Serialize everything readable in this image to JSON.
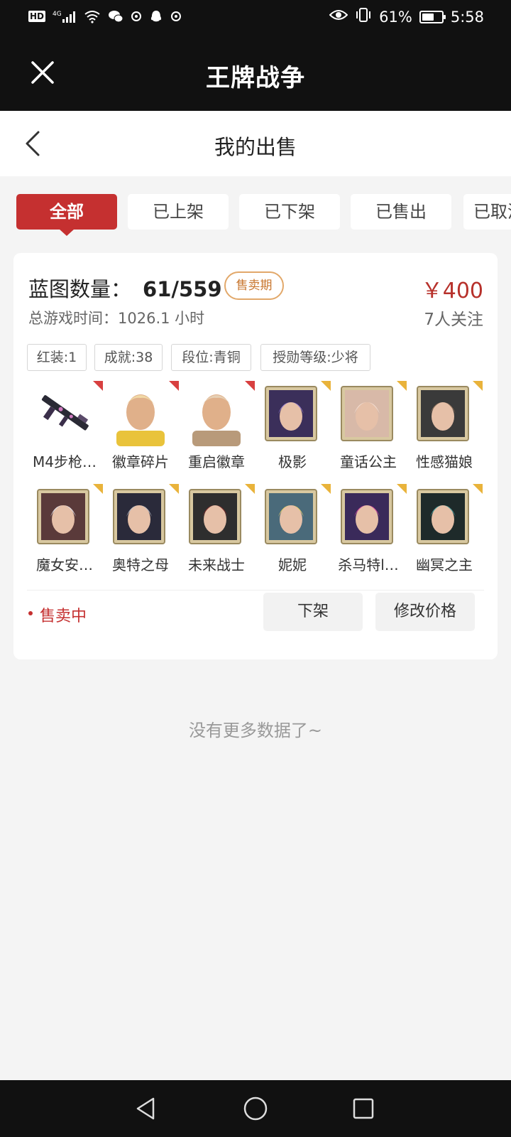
{
  "status_bar": {
    "hd": "HD",
    "network": "4G",
    "battery_percent": "61%",
    "battery_level": 0.61,
    "time": "5:58",
    "icons": [
      "hd-icon",
      "signal-icon",
      "wifi-icon",
      "wechat-icon",
      "app-icon",
      "qq-icon",
      "app-icon-2",
      "eye-icon",
      "vibrate-icon",
      "battery-icon"
    ]
  },
  "app_title": "王牌战争",
  "page_title": "我的出售",
  "tabs": [
    {
      "label": "全部",
      "active": true
    },
    {
      "label": "已上架",
      "active": false
    },
    {
      "label": "已下架",
      "active": false
    },
    {
      "label": "已售出",
      "active": false
    },
    {
      "label": "已取消",
      "active": false
    }
  ],
  "listing": {
    "title_label": "蓝图数量：",
    "title_count": "61/559",
    "badge": "售卖期",
    "price": "￥400",
    "playtime": "总游戏时间：1026.1 小时",
    "followers": "7人关注",
    "tags": [
      "红装:1",
      "成就:38",
      "段位:青铜",
      "授勋等级:少将"
    ],
    "items": [
      {
        "label": "M4步枪…",
        "corner": "red",
        "icon": "rifle-icon"
      },
      {
        "label": "徽章碎片",
        "corner": "red",
        "icon": "avatar-icon"
      },
      {
        "label": "重启徽章",
        "corner": "red",
        "icon": "avatar-icon"
      },
      {
        "label": "极影",
        "corner": "gold",
        "icon": "portrait-icon"
      },
      {
        "label": "童话公主",
        "corner": "gold",
        "icon": "portrait-icon"
      },
      {
        "label": "性感猫娘",
        "corner": "gold",
        "icon": "portrait-icon"
      },
      {
        "label": "魔女安…",
        "corner": "gold",
        "icon": "portrait-icon"
      },
      {
        "label": "奥特之母",
        "corner": "gold",
        "icon": "portrait-icon"
      },
      {
        "label": "未来战士",
        "corner": "gold",
        "icon": "portrait-icon"
      },
      {
        "label": "妮妮",
        "corner": "gold",
        "icon": "portrait-icon"
      },
      {
        "label": "杀马特l…",
        "corner": "gold",
        "icon": "portrait-icon"
      },
      {
        "label": "幽冥之主",
        "corner": "gold",
        "icon": "portrait-icon"
      }
    ],
    "status": "售卖中",
    "delist_button": "下架",
    "edit_price_button": "修改价格"
  },
  "no_more": "没有更多数据了~",
  "colors": {
    "accent": "#c53030",
    "price": "#b7312b",
    "badge": "#c8762e",
    "corner_red": "#d84040",
    "corner_gold": "#e9b33b"
  }
}
